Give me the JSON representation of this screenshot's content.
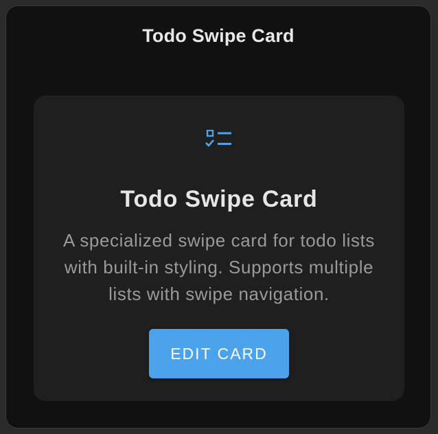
{
  "window": {
    "title": "Todo Swipe Card"
  },
  "card": {
    "icon": "todo-checklist-icon",
    "title": "Todo Swipe Card",
    "description": "A specialized swipe card for todo lists with built-in styling. Supports multiple lists with swipe navigation.",
    "edit_button_label": "EDIT CARD"
  },
  "colors": {
    "accent": "#4ba3ec",
    "background": "#111111",
    "card_background": "#1f1f1f",
    "title_text": "#e6e6e6",
    "description_text": "#9a9a9a"
  }
}
